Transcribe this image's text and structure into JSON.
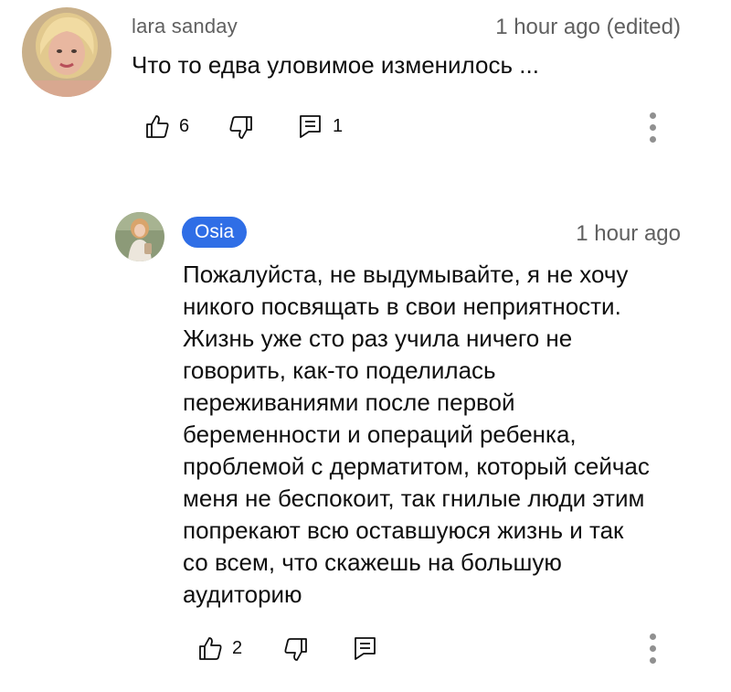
{
  "comments": [
    {
      "author": "lara sanday",
      "time": "1 hour ago (edited)",
      "text_lines": [
        "Что то едва уловимое изменилось ..."
      ],
      "likes": "6",
      "replies": "1",
      "avatar_icon": "user-photo-blonde"
    },
    {
      "author": "Osia",
      "author_badge_color": "#2f6ee6",
      "time": "1 hour ago",
      "text_lines": [
        "Пожалуйста, не выдумывайте, я не хочу",
        "никого посвящать в свои неприятности.",
        "Жизнь уже сто раз учила ничего не",
        "говорить, как-то поделилась",
        "переживаниями после первой",
        "беременности и операций ребенка,",
        "проблемой с дерматитом, который сейчас",
        "меня не беспокоит, так гнилые люди этим",
        "попрекают всю оставшуюся жизнь и так",
        "со всем, что скажешь на большую",
        "аудиторию"
      ],
      "likes": "2",
      "avatar_icon": "user-photo-outdoor"
    }
  ],
  "icons": {
    "like": "thumbs-up-icon",
    "dislike": "thumbs-down-icon",
    "reply": "reply-comment-icon",
    "more": "more-vert-icon"
  }
}
